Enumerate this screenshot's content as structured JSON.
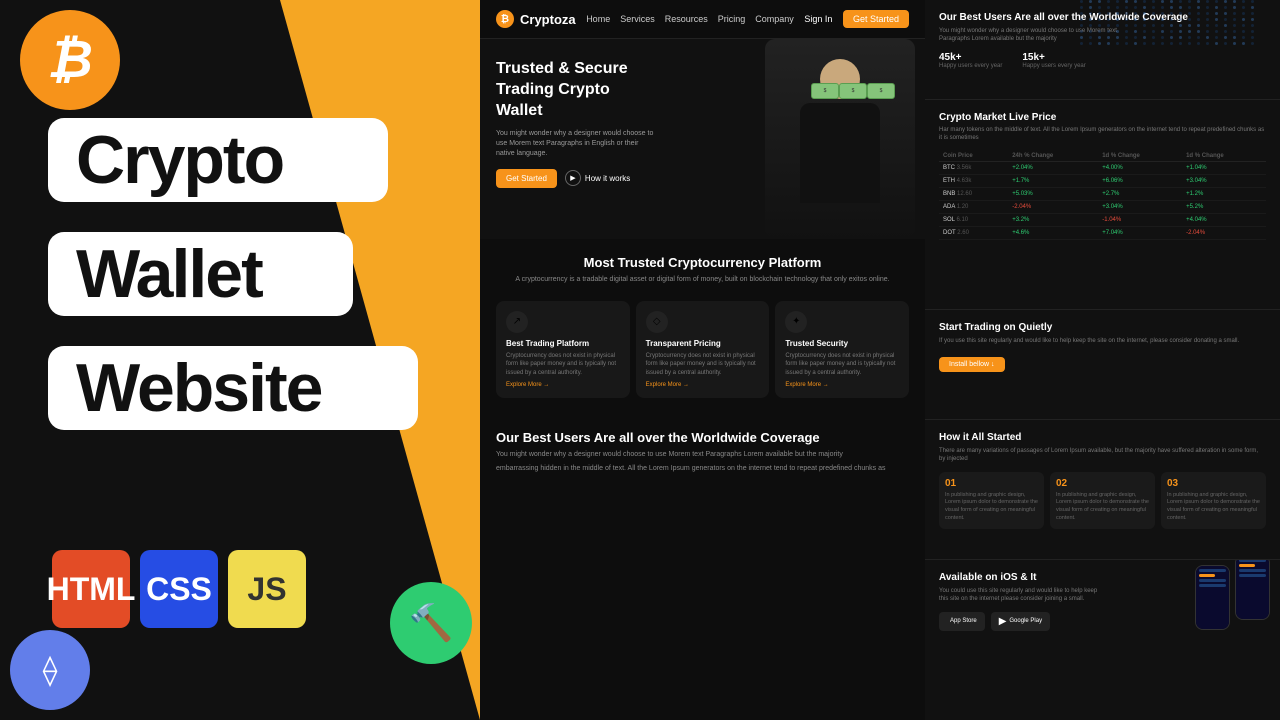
{
  "left": {
    "title": "Crypto Wallet Website",
    "badge_crypto": "Crypto",
    "badge_wallet": "Wallet",
    "badge_website": "Website",
    "logos": {
      "html": "HTML",
      "css": "CSS",
      "js": "JS"
    }
  },
  "nav": {
    "logo": "Cryptoza",
    "links": [
      "Home",
      "Services",
      "Resources",
      "Pricing",
      "Company"
    ],
    "signin": "Sign In",
    "get_started": "Get Started"
  },
  "hero": {
    "title": "Trusted & Secure Trading Crypto Wallet",
    "description": "You might wonder why a designer would choose to use Morem text Paragraphs in English or their native language.",
    "btn_started": "Get Started",
    "btn_how": "How it works"
  },
  "trusted": {
    "title": "Most Trusted Cryptocurrency Platform",
    "description": "A cryptocurrency is a tradable digital asset or digital form of money, built on blockchain technology that only exitos online."
  },
  "features": [
    {
      "icon": "↗",
      "title": "Best Trading Platform",
      "description": "Cryptocurrency does not exist in physical form like paper money and is typically not issued by a central authority.",
      "link": "Explore More →"
    },
    {
      "icon": "◇",
      "title": "Transparent Pricing",
      "description": "Cryptocurrency does not exist in physical form like paper money and is typically not issued by a central authority.",
      "link": "Explore More →"
    },
    {
      "icon": "✦",
      "title": "Trusted Security",
      "description": "Cryptocurrency does not exist in physical form like paper money and is typically not issued by a central authority.",
      "link": "Explore More →"
    }
  ],
  "coverage": {
    "title": "Our Best Users Are all over the Worldwide Coverage",
    "description": "You might wonder why a designer would choose to use Morem text Paragraphs Lorem available but the majority",
    "more_text": "embarrassing hidden in the middle of text. All the Lorem Ipsum generators on the internet tend to repeat predefined chunks as"
  },
  "right_coverage": {
    "title": "Our Best Users Are all over the Worldwide Coverage",
    "description": "You might wonder why a designer would choose to use Morem text Paragraphs Lorem available but the majority",
    "stats": [
      {
        "num": "45k+",
        "label": "Happy users every year"
      },
      {
        "num": "15k+",
        "label": "Happy users every year"
      }
    ]
  },
  "market": {
    "title": "Crypto Market Live Price",
    "subtitle": "Har many tokens on the middle of text. All the Lorem Ipsum generators on the internet tend to repeat predefined chunks as it is sometimes",
    "headers": [
      "Coin Price",
      "24h % Change",
      "1d % Change",
      "1d % Change"
    ],
    "rows": [
      {
        "coin": "BTC",
        "price": "3.56k",
        "h24": "+2.04%",
        "d1c": "+4.00%",
        "d1ch": "+1.04%"
      },
      {
        "coin": "ETH",
        "price": "4.63k",
        "h24": "+1.7%",
        "d1c": "+6.06%",
        "d1ch": "+3.04%"
      },
      {
        "coin": "BNB",
        "price": "12.60",
        "h24": "+5.03%",
        "d1c": "+2.7%",
        "d1ch": "+1.2%"
      },
      {
        "coin": "ADA",
        "price": "1.20",
        "h24": "-2.04%",
        "d1c": "+3.04%",
        "d1ch": "+5.2%"
      },
      {
        "coin": "SOL",
        "price": "6.10",
        "h24": "+3.2%",
        "d1c": "-1.04%",
        "d1ch": "+4.04%"
      },
      {
        "coin": "DOT",
        "price": "2.60",
        "h24": "+4.6%",
        "d1c": "+7.04%",
        "d1ch": "-2.04%"
      }
    ]
  },
  "trading": {
    "title": "Start Trading on Quietly",
    "description": "If you use this site regularly and would like to help keep the site on the internet, please consider donating a small.",
    "btn": "Install bellow ↓"
  },
  "how": {
    "title": "How it All Started",
    "description": "There are many variations of passages of Lorem Ipsum available, but the majority have suffered alteration in some form, by injected",
    "steps": [
      {
        "num": "01",
        "text": "In publishing and graphic design, Lorem ipsum dolor to demonstrate the visual form of creating on meaningful content."
      },
      {
        "num": "02",
        "text": "In publishing and graphic design, Lorem ipsum dolor to demonstrate the visual form of creating on meaningful content."
      },
      {
        "num": "03",
        "text": "In publishing and graphic design, Lorem ipsum dolor to demonstrate the visual form of creating on meaningful content."
      }
    ]
  },
  "ios": {
    "title": "Available on iOS & It",
    "description": "You could use this site regularly and would like to help keep this site on the internet please consider joining a small.",
    "btn_appstore": "App Store",
    "btn_google": "Google Play"
  }
}
